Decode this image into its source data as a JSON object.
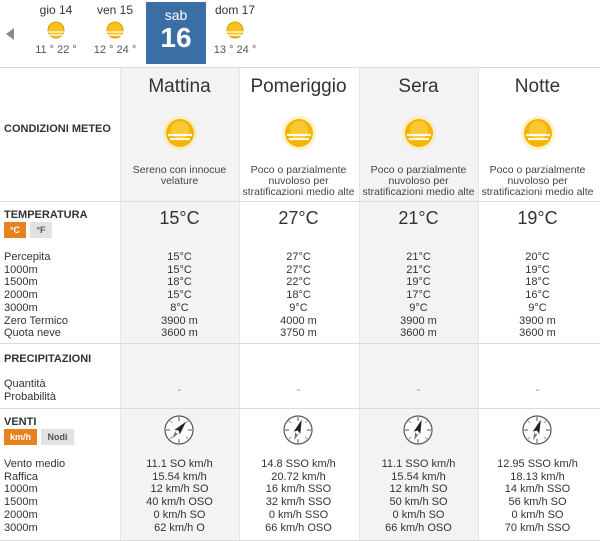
{
  "days": [
    {
      "name": "gio 14",
      "temps": "11 ° 22 °"
    },
    {
      "name": "ven 15",
      "temps": "12 ° 24 °"
    },
    {
      "name": "dom 17",
      "temps": "13 ° 24 °"
    }
  ],
  "active_day": {
    "name": "sab",
    "number": "16"
  },
  "periods": [
    {
      "title": "Mattina",
      "desc": "Sereno con innocue velature",
      "temp": "15°C",
      "temp_rows": [
        "15°C",
        "15°C",
        "18°C",
        "15°C",
        "8°C",
        "3900 m",
        "3600 m"
      ],
      "precip": "-",
      "wind_rows": [
        "11.1 SO km/h",
        "15.54 km/h",
        "12 km/h SO",
        "40 km/h OSO",
        "0 km/h SO",
        "62 km/h O"
      ],
      "wind_angle": 40
    },
    {
      "title": "Pomeriggio",
      "desc": "Poco o parzialmente nuvoloso per stratificazioni medio alte",
      "temp": "27°C",
      "temp_rows": [
        "27°C",
        "27°C",
        "22°C",
        "18°C",
        "9°C",
        "4000 m",
        "3750 m"
      ],
      "precip": "-",
      "wind_rows": [
        "14.8 SSO km/h",
        "20.72 km/h",
        "16 km/h SSO",
        "32 km/h SSO",
        "0 km/h SSO",
        "66 km/h OSO"
      ],
      "wind_angle": 20
    },
    {
      "title": "Sera",
      "desc": "Poco o parzialmente nuvoloso per stratificazioni medio alte",
      "temp": "21°C",
      "temp_rows": [
        "21°C",
        "21°C",
        "19°C",
        "17°C",
        "9°C",
        "3900 m",
        "3600 m"
      ],
      "precip": "-",
      "wind_rows": [
        "11.1 SSO km/h",
        "15.54 km/h",
        "12 km/h SO",
        "50 km/h SO",
        "0 km/h SO",
        "66 km/h OSO"
      ],
      "wind_angle": 20
    },
    {
      "title": "Notte",
      "desc": "Poco o parzialmente nuvoloso per stratificazioni medio alte",
      "temp": "19°C",
      "temp_rows": [
        "20°C",
        "19°C",
        "18°C",
        "16°C",
        "9°C",
        "3900 m",
        "3600 m"
      ],
      "precip": "-",
      "wind_rows": [
        "12.95 SSO km/h",
        "18.13 km/h",
        "14 km/h SSO",
        "56 km/h SO",
        "0 km/h SO",
        "70 km/h SSO"
      ],
      "wind_angle": 20
    }
  ],
  "labels": {
    "conditions": "CONDIZIONI METEO",
    "temperature": "TEMPERATURA",
    "precipitation": "PRECIPITAZIONI",
    "wind": "VENTI",
    "temp_rows": [
      "Percepita",
      "1000m",
      "1500m",
      "2000m",
      "3000m",
      "Zero Termico",
      "Quota neve"
    ],
    "precip_rows": [
      "Quantità",
      "Probabilità"
    ],
    "wind_rows": [
      "Vento medio",
      "Raffica",
      "1000m",
      "1500m",
      "2000m",
      "3000m"
    ]
  },
  "units": {
    "celsius": "°C",
    "fahrenheit": "°F",
    "kmh": "km/h",
    "knots": "Nodi"
  },
  "colors": {
    "active_day": "#3a6ea5",
    "unit_on": "#e8821e",
    "sun": "#f5b400"
  },
  "icons": {
    "weather": "sun-with-haze-icon",
    "wind": "compass-wind-icon",
    "nav": "arrow-left-icon"
  }
}
